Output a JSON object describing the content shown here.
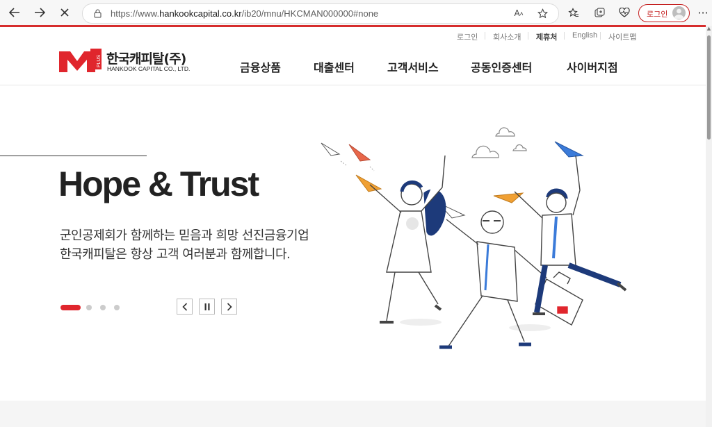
{
  "browser": {
    "url_prefix": "https://www.",
    "url_domain": "hankookcapital.co.kr",
    "url_path": "/ib20/mnu/HKCMAN000000#none",
    "login_label": "로그인",
    "icons": [
      "back-icon",
      "forward-icon",
      "stop-icon",
      "lock-icon",
      "read-aloud-icon",
      "favorite-star-icon",
      "favorites-icon",
      "collections-icon",
      "health-icon",
      "more-icon"
    ]
  },
  "utility_nav": [
    "로그인",
    "회사소개",
    "제휴처",
    "English",
    "사이트맵"
  ],
  "logo": {
    "korean": "한국캐피탈(주)",
    "english": "HANKOOK CAPITAL CO., LTD.",
    "badge": "PLUS"
  },
  "gnb": [
    "금융상품",
    "대출센터",
    "고객서비스",
    "공동인증센터",
    "사이버지점"
  ],
  "hero": {
    "title": "Hope & Trust",
    "line1": "군인공제회가 함께하는 믿음과 희망 선진금융기업",
    "line2": "한국캐피탈은 항상 고객 여러분과 함께합니다."
  },
  "slider": {
    "active_index": 1,
    "total": 4,
    "prev_icon": "chevron-left-icon",
    "pause_icon": "pause-icon",
    "next_icon": "chevron-right-icon"
  },
  "colors": {
    "brand_red": "#e0262d",
    "accent_orange": "#f0a033",
    "accent_blue": "#3b7bd9",
    "navy": "#1d3a7a"
  }
}
